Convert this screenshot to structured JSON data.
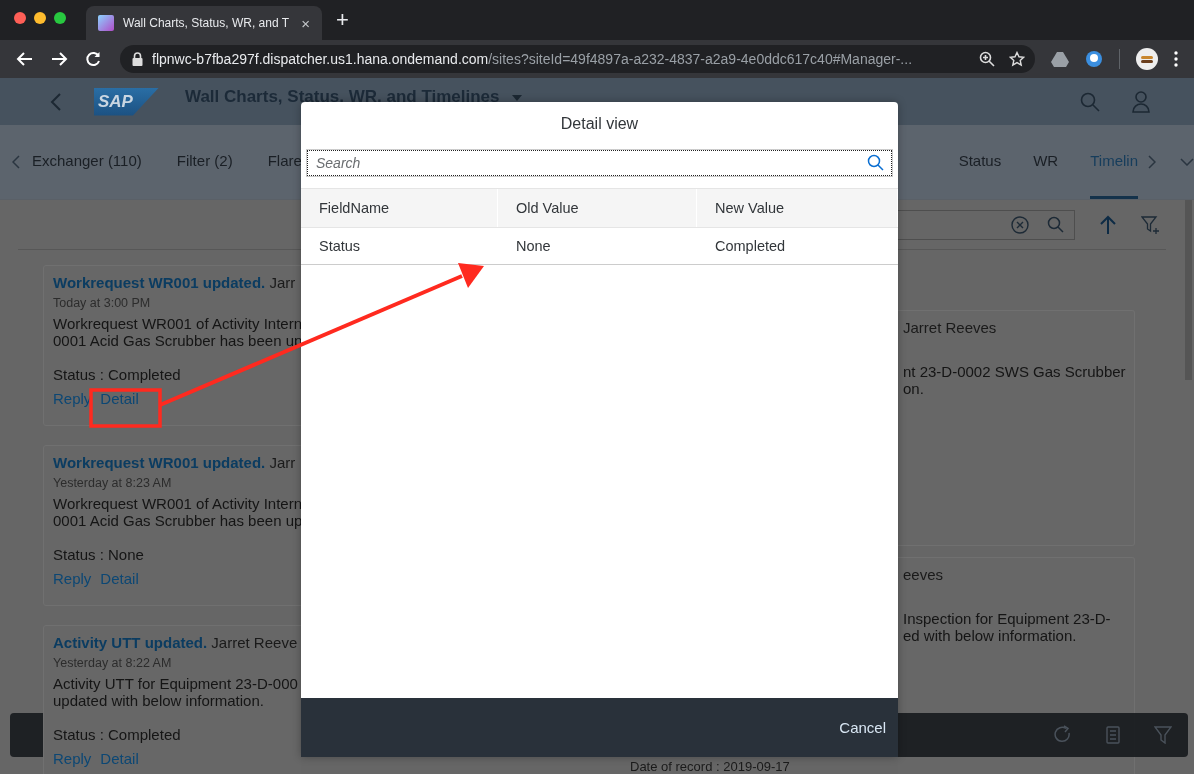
{
  "browser": {
    "tab_title": "Wall Charts, Status, WR, and T",
    "tab_close": "×",
    "new_tab": "+",
    "url_host": "flpnwc-b7fba297f.dispatcher.us1.hana.ondemand.com",
    "url_path": "/sites?siteId=49f4897a-a232-4837-a2a9-4e0ddc617c40#Manager-..."
  },
  "shell": {
    "logo": "SAP",
    "title": "Wall Charts, Status, WR, and Timelines"
  },
  "tabs": [
    {
      "label": "Exchanger (110)",
      "selected": false
    },
    {
      "label": "Filter (2)",
      "selected": false
    },
    {
      "label": "Flare",
      "selected": false
    },
    {
      "label": "Status",
      "selected": false
    },
    {
      "label": "WR",
      "selected": false
    },
    {
      "label": "Timelin",
      "selected": true
    }
  ],
  "timeline_left": [
    {
      "title": "Workrequest WR001 updated.",
      "author": "Jarr",
      "time": "Today at 3:00 PM",
      "body": [
        "Workrequest WR001 of Activity Intern",
        "0001 Acid Gas Scrubber has been up"
      ],
      "status": "Status : Completed",
      "actions": [
        "Reply",
        "Detail"
      ]
    },
    {
      "title": "Workrequest WR001 updated.",
      "author": "Jarr",
      "time": "Yesterday at 8:23 AM",
      "body": [
        "Workrequest WR001 of Activity Intern",
        "0001 Acid Gas Scrubber has been up"
      ],
      "status": "Status : None",
      "actions": [
        "Reply",
        "Detail"
      ]
    },
    {
      "title": "Activity UTT updated.",
      "author": "Jarret Reeve",
      "time": "Yesterday at 8:22 AM",
      "body": [
        "Activity UTT for Equipment 23-D-000",
        "updated with below information."
      ],
      "status": "Status : Completed",
      "actions": [
        "Reply",
        "Detail"
      ]
    }
  ],
  "timeline_right": [
    {
      "author": "Jarret Reeves",
      "body": [
        "nt 23-D-0002 SWS Gas Scrubber",
        "on."
      ]
    },
    {
      "author": "eeves",
      "body": [
        "Inspection for Equipment 23-D-",
        "ed with below information."
      ]
    }
  ],
  "date_of_record": "Date of record : 2019-09-17",
  "dialog": {
    "title": "Detail view",
    "search": {
      "placeholder": "Search"
    },
    "columns": [
      "FieldName",
      "Old Value",
      "New Value"
    ],
    "rows": [
      [
        "Status",
        "None",
        "Completed"
      ]
    ],
    "cancel": "Cancel"
  }
}
